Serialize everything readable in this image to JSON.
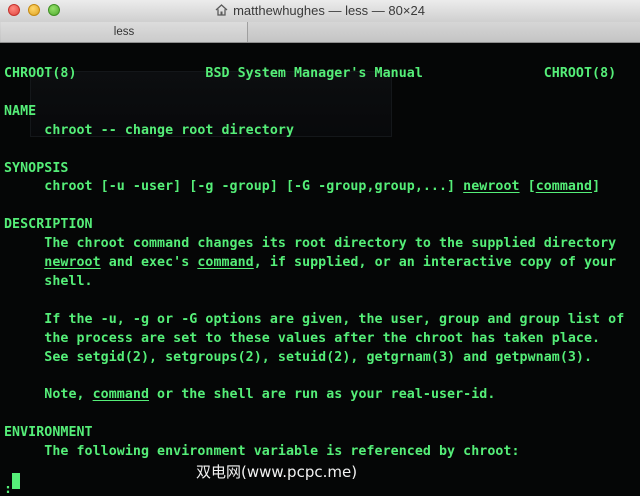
{
  "window": {
    "title": "matthewhughes — less — 80×24",
    "tab_label": "less"
  },
  "colors": {
    "terminal_text": "#55ee78",
    "terminal_bg": "#050606"
  },
  "lines": [
    [
      {
        "t": "CHROOT(8)                BSD System Manager's Manual               CHROOT(8)"
      }
    ],
    [
      {
        "t": ""
      }
    ],
    [
      {
        "t": "NAME"
      }
    ],
    [
      {
        "t": "     chroot -- change root directory"
      }
    ],
    [
      {
        "t": ""
      }
    ],
    [
      {
        "t": "SYNOPSIS"
      }
    ],
    [
      {
        "t": "     chroot [-u -user] [-g -group] [-G -group,group,...] "
      },
      {
        "t": "newroot",
        "u": true
      },
      {
        "t": " ["
      },
      {
        "t": "command",
        "u": true
      },
      {
        "t": "]"
      }
    ],
    [
      {
        "t": ""
      }
    ],
    [
      {
        "t": "DESCRIPTION"
      }
    ],
    [
      {
        "t": "     The chroot command changes its root directory to the supplied directory"
      }
    ],
    [
      {
        "t": "     "
      },
      {
        "t": "newroot",
        "u": true
      },
      {
        "t": " and exec's "
      },
      {
        "t": "command",
        "u": true
      },
      {
        "t": ", if supplied, or an interactive copy of your"
      }
    ],
    [
      {
        "t": "     shell."
      }
    ],
    [
      {
        "t": ""
      }
    ],
    [
      {
        "t": "     If the -u, -g or -G options are given, the user, group and group list of"
      }
    ],
    [
      {
        "t": "     the process are set to these values after the chroot has taken place."
      }
    ],
    [
      {
        "t": "     See setgid(2), setgroups(2), setuid(2), getgrnam(3) and getpwnam(3)."
      }
    ],
    [
      {
        "t": ""
      }
    ],
    [
      {
        "t": "     Note, "
      },
      {
        "t": "command",
        "u": true
      },
      {
        "t": " or the shell are run as your real-user-id."
      }
    ],
    [
      {
        "t": ""
      }
    ],
    [
      {
        "t": "ENVIRONMENT"
      }
    ],
    [
      {
        "t": "     The following environment variable is referenced by chroot:"
      }
    ],
    [
      {
        "t": ""
      }
    ],
    [
      {
        "t": ":"
      }
    ]
  ],
  "watermark": "双电网(www.pcpc.me)"
}
